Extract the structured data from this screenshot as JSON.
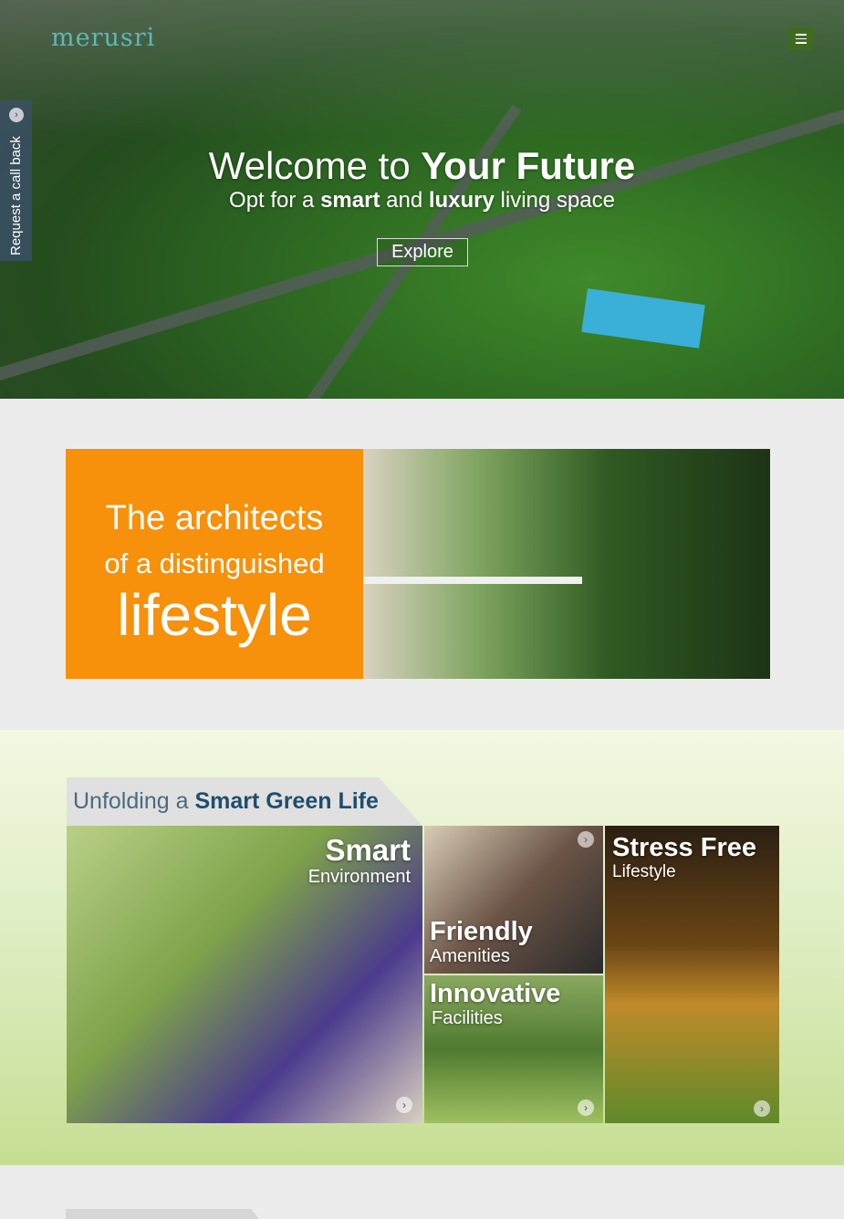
{
  "header": {
    "logo": "merusri",
    "menu_icon": "hamburger-icon"
  },
  "callback": {
    "label": "Request a call back",
    "icon": "chevron-right-icon"
  },
  "hero": {
    "title_light": "Welcome to ",
    "title_bold": "Your Future",
    "subtitle_parts": [
      "Opt for a ",
      "smart",
      " and ",
      "luxury",
      " living space"
    ],
    "button": "Explore"
  },
  "architects": {
    "line1": "The architects",
    "line2": "of a distinguished",
    "line3": "lifestyle",
    "accent": "#f7900a"
  },
  "green_life": {
    "heading_light": "Unfolding a ",
    "heading_bold": "Smart Green Life",
    "tiles": [
      {
        "title": "Smart",
        "subtitle": "Environment"
      },
      {
        "title": "Friendly",
        "subtitle": "Amenities"
      },
      {
        "title": "Innovative",
        "subtitle": "Facilities"
      },
      {
        "title": "Stress Free",
        "subtitle": "Lifestyle"
      }
    ]
  }
}
